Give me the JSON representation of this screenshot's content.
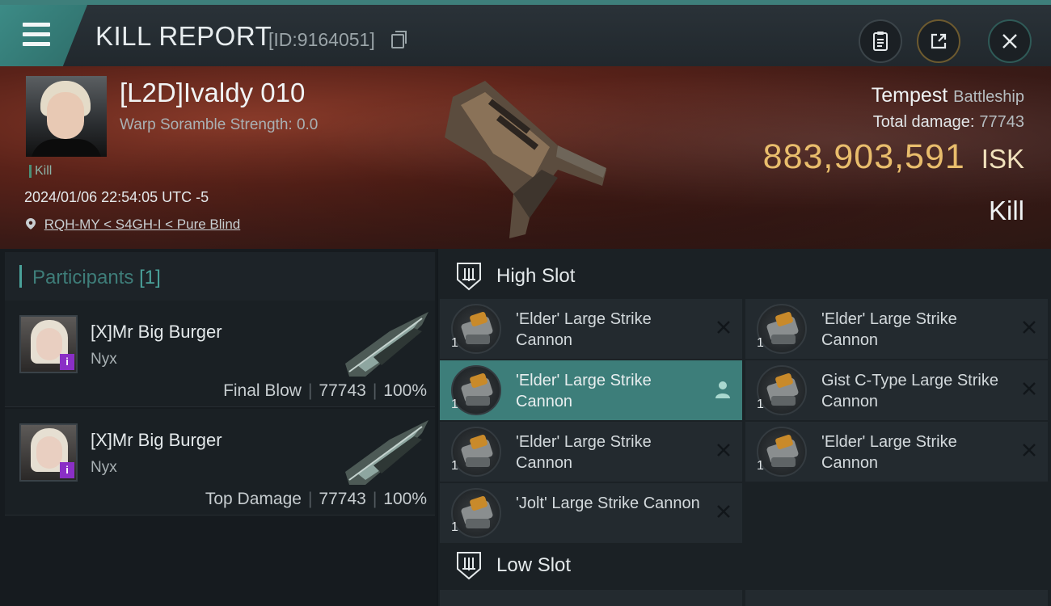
{
  "header": {
    "title": "KILL REPORT",
    "report_id": "[ID:9164051]",
    "buttons": [
      "clipboard-icon",
      "share-icon",
      "close-icon"
    ]
  },
  "victim": {
    "name": "[L2D]Ivaldy 010",
    "warp_scramble": "Warp Soramble Strength: 0.0",
    "tag": "Kill",
    "datetime": "2024/01/06 22:54:05 UTC -5",
    "location": "RQH-MY < S4GH-I < Pure Blind",
    "ship_name": "Tempest",
    "ship_class": "Battleship",
    "total_damage_label": "Total damage:",
    "total_damage": "77743",
    "isk_value": "883,903,591",
    "isk_unit": "ISK",
    "result": "Kill"
  },
  "participants": {
    "label": "Participants",
    "count": "[1]",
    "items": [
      {
        "name": "[X]Mr Big Burger",
        "ship": "Nyx",
        "role": "Final Blow",
        "damage": "77743",
        "percent": "100%",
        "badge": "i"
      },
      {
        "name": "[X]Mr Big Burger",
        "ship": "Nyx",
        "role": "Top Damage",
        "damage": "77743",
        "percent": "100%",
        "badge": "i"
      }
    ]
  },
  "slots": {
    "high_label": "High Slot",
    "low_label": "Low Slot",
    "high_modules": [
      {
        "name": "'Elder' Large Strike Cannon",
        "qty": "1",
        "status": "destroyed"
      },
      {
        "name": "'Elder' Large Strike Cannon",
        "qty": "1",
        "status": "destroyed"
      },
      {
        "name": "'Elder' Large Strike Cannon",
        "qty": "1",
        "status": "dropped"
      },
      {
        "name": "Gist C-Type Large Strike Cannon",
        "qty": "1",
        "status": "destroyed"
      },
      {
        "name": "'Elder' Large Strike Cannon",
        "qty": "1",
        "status": "destroyed"
      },
      {
        "name": "'Elder' Large Strike Cannon",
        "qty": "1",
        "status": "destroyed"
      },
      {
        "name": "'Jolt' Large Strike Cannon",
        "qty": "1",
        "status": "destroyed"
      }
    ]
  },
  "colors": {
    "accent": "#3d7e7a",
    "isk": "#e9bd6c",
    "badge": "#8a2fc6"
  }
}
